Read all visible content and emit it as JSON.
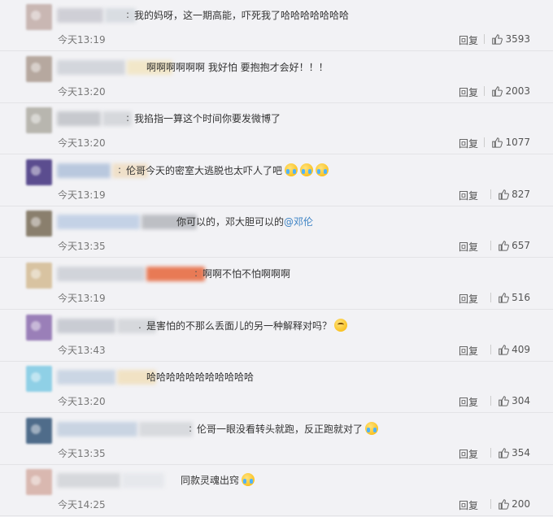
{
  "reply_label": "回复",
  "comments": [
    {
      "text": "我的妈呀，这一期高能，吓死我了哈哈哈哈哈哈哈",
      "time": "今天13:19",
      "likes": "3593",
      "sep": ":",
      "emojis": [],
      "avatar_color": "#c9b7b3",
      "name_colors": [
        "#cfcfd6",
        "#d9dde2"
      ],
      "name_width": 95
    },
    {
      "text": "啊啊啊啊啊啊 我好怕 要抱抱才会好！！！",
      "time": "今天13:20",
      "likes": "2003",
      "sep": "",
      "emojis": [],
      "avatar_color": "#b6a89f",
      "name_colors": [
        "#d3d6dc",
        "#f2e7c9"
      ],
      "name_width": 140
    },
    {
      "text": "我掐指一算这个时间你要发微博了",
      "time": "今天13:20",
      "likes": "1077",
      "sep": ":",
      "emojis": [],
      "avatar_color": "#b8b6af",
      "name_colors": [
        "#c7c9ce",
        "#d6d8dc"
      ],
      "name_width": 90
    },
    {
      "text": "伦哥今天的密室大逃脱也太吓人了吧",
      "time": "今天13:19",
      "likes": "827",
      "sep": ":",
      "emojis": [
        "cry",
        "cry",
        "cry"
      ],
      "avatar_color": "#5b4d8f",
      "name_colors": [
        "#b9c8de",
        "#efe0c9"
      ],
      "name_width": 110
    },
    {
      "text": "你可以的，邓大胆可以的",
      "mention": "@邓伦",
      "time": "今天13:35",
      "likes": "657",
      "sep": "",
      "emojis": [],
      "avatar_color": "#8a7f6d",
      "name_colors": [
        "#c4d2e6",
        "#bdbfc4"
      ],
      "name_width": 170
    },
    {
      "text": "啊啊不怕不怕啊啊啊",
      "time": "今天13:19",
      "likes": "516",
      "sep": ":",
      "emojis": [],
      "avatar_color": "#d8c3a1",
      "name_colors": [
        "#d1d4da",
        "#e87a55"
      ],
      "name_width": 180
    },
    {
      "text": "是害怕的不那么丢面儿的另一种解释对吗？",
      "time": "今天13:43",
      "likes": "409",
      "sep": ".",
      "emojis": [
        "smile"
      ],
      "avatar_color": "#9a7fb8",
      "name_colors": [
        "#c9ccd3",
        "#d6d8dc"
      ],
      "name_width": 120
    },
    {
      "text": "哈哈哈哈哈哈哈哈哈哈哈",
      "time": "今天13:20",
      "likes": "304",
      "sep": "",
      "emojis": [],
      "avatar_color": "#8fd0e6",
      "name_colors": [
        "#cbd6e4",
        "#f1e2c4"
      ],
      "name_width": 120
    },
    {
      "text": "伦哥一眼没看转头就跑，反正跑就对了",
      "time": "今天13:35",
      "likes": "354",
      "sep": ":",
      "emojis": [
        "cry"
      ],
      "avatar_color": "#4f6c8a",
      "name_colors": [
        "#c9d4e2",
        "#d8dade"
      ],
      "name_width": 165
    },
    {
      "text": "同款灵魂出窍",
      "time": "今天14:25",
      "likes": "200",
      "sep": "",
      "emojis": [
        "cry"
      ],
      "avatar_color": "#d9b8b0",
      "name_colors": [
        "#d6d8dc",
        "#e6e8ec"
      ],
      "name_width": 130
    }
  ],
  "text_offsets": [
    165,
    180,
    165,
    155,
    217,
    249,
    180,
    180,
    242,
    222
  ]
}
